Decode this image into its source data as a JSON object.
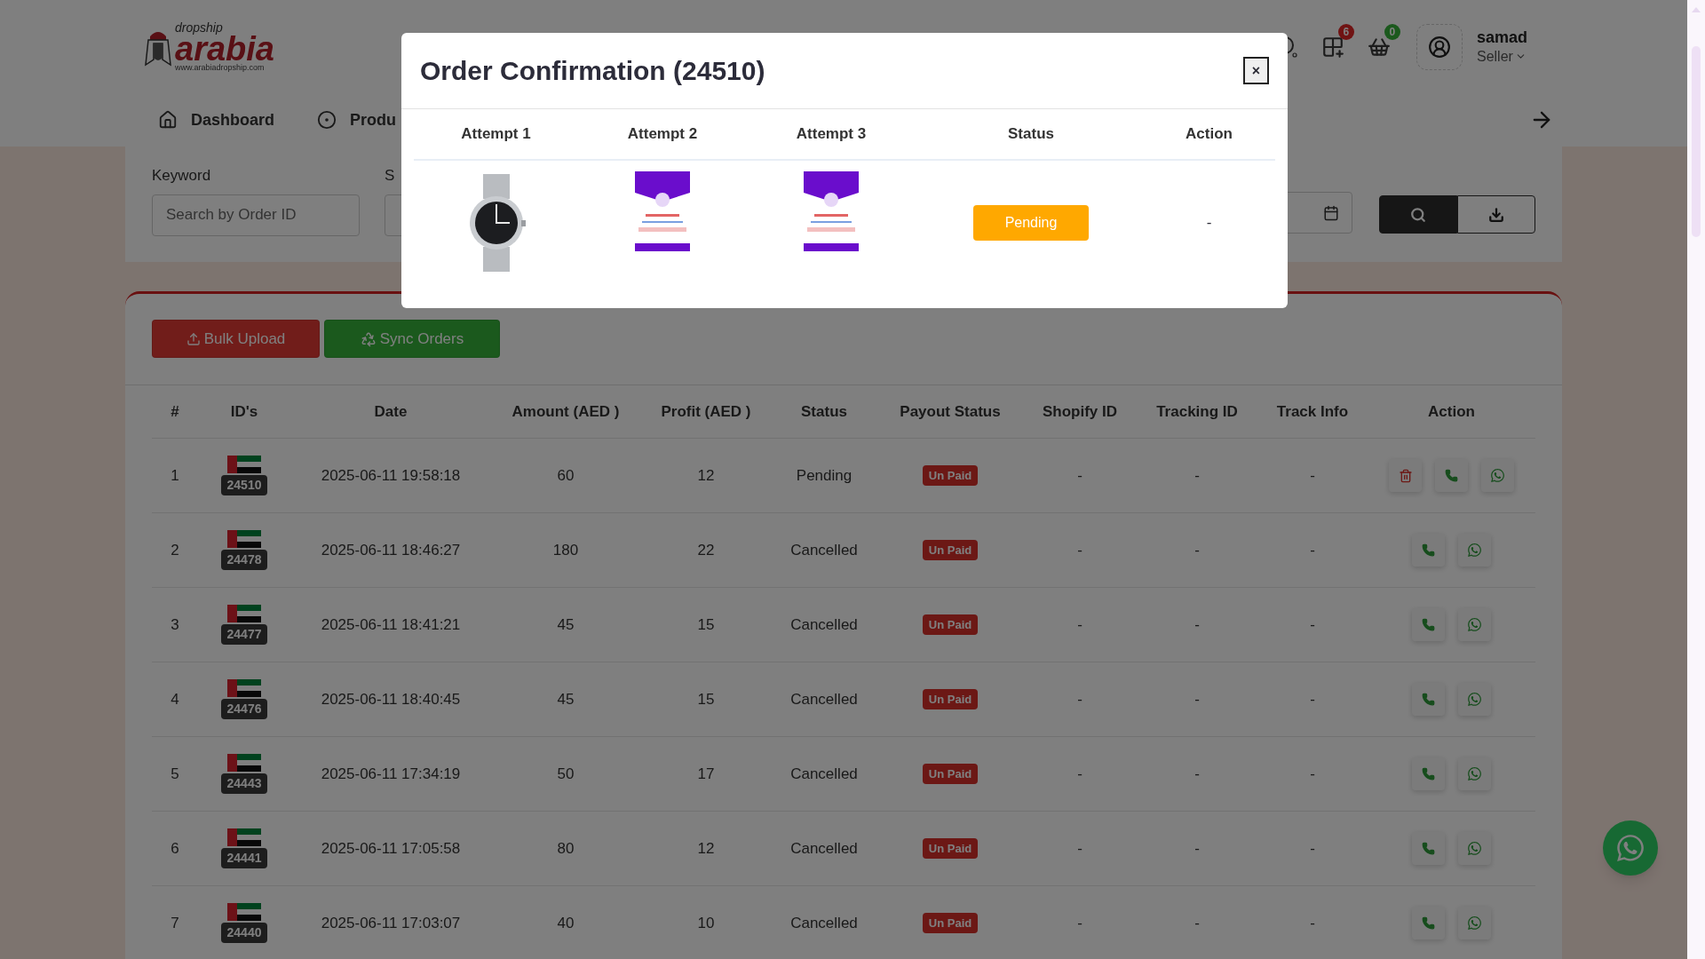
{
  "logo": {
    "top": "dropship",
    "main": "arabia",
    "url": "www.arabiadropship.com"
  },
  "nav": [
    {
      "kind": "home",
      "label": "Dashboard"
    },
    {
      "kind": "target",
      "label": "Produ"
    }
  ],
  "header_icons": [
    {
      "kind": "search"
    },
    {
      "kind": "apps",
      "count": "6"
    },
    {
      "kind": "basket",
      "count": "0"
    }
  ],
  "user": {
    "name": "samad",
    "role": "Seller"
  },
  "filters": {
    "keyword_label": "Keyword",
    "keyword_placeholder": "Search by Order ID",
    "second_label": "S"
  },
  "toolbar": [
    {
      "kind": "upload",
      "label": "Bulk Upload"
    },
    {
      "kind": "sync",
      "label": "Sync Orders"
    }
  ],
  "table": {
    "columns": [
      "#",
      "ID's",
      "Date",
      "Amount (AED )",
      "Profit (AED )",
      "Status",
      "Payout Status",
      "Shopify ID",
      "Tracking ID",
      "Track Info",
      "Action"
    ],
    "rows": [
      {
        "index": "1",
        "id": "24510",
        "date": "2025-06-11 19:58:18",
        "amount": "60",
        "profit": "12",
        "status": "Pending",
        "payout": "Un Paid",
        "shopify": "-",
        "tracking": "-",
        "track_info": "-",
        "can_delete": true
      },
      {
        "index": "2",
        "id": "24478",
        "date": "2025-06-11 18:46:27",
        "amount": "180",
        "profit": "22",
        "status": "Cancelled",
        "payout": "Un Paid",
        "shopify": "-",
        "tracking": "-",
        "track_info": "-",
        "can_delete": false
      },
      {
        "index": "3",
        "id": "24477",
        "date": "2025-06-11 18:41:21",
        "amount": "45",
        "profit": "15",
        "status": "Cancelled",
        "payout": "Un Paid",
        "shopify": "-",
        "tracking": "-",
        "track_info": "-",
        "can_delete": false
      },
      {
        "index": "4",
        "id": "24476",
        "date": "2025-06-11 18:40:45",
        "amount": "45",
        "profit": "15",
        "status": "Cancelled",
        "payout": "Un Paid",
        "shopify": "-",
        "tracking": "-",
        "track_info": "-",
        "can_delete": false
      },
      {
        "index": "5",
        "id": "24443",
        "date": "2025-06-11 17:34:19",
        "amount": "50",
        "profit": "17",
        "status": "Cancelled",
        "payout": "Un Paid",
        "shopify": "-",
        "tracking": "-",
        "track_info": "-",
        "can_delete": false
      },
      {
        "index": "6",
        "id": "24441",
        "date": "2025-06-11 17:05:58",
        "amount": "80",
        "profit": "12",
        "status": "Cancelled",
        "payout": "Un Paid",
        "shopify": "-",
        "tracking": "-",
        "track_info": "-",
        "can_delete": false
      },
      {
        "index": "7",
        "id": "24440",
        "date": "2025-06-11 17:03:07",
        "amount": "40",
        "profit": "10",
        "status": "Cancelled",
        "payout": "Un Paid",
        "shopify": "-",
        "tracking": "-",
        "track_info": "-",
        "can_delete": false
      }
    ]
  },
  "modal": {
    "title": "Order Confirmation (**24510**)",
    "close": "×",
    "columns": [
      "Attempt 1",
      "Attempt 2",
      "Attempt 3",
      "Status",
      "Action"
    ],
    "attempts": [
      {
        "kind": "watch"
      },
      {
        "kind": "label"
      },
      {
        "kind": "label"
      }
    ],
    "status": "Pending",
    "action": "-"
  }
}
